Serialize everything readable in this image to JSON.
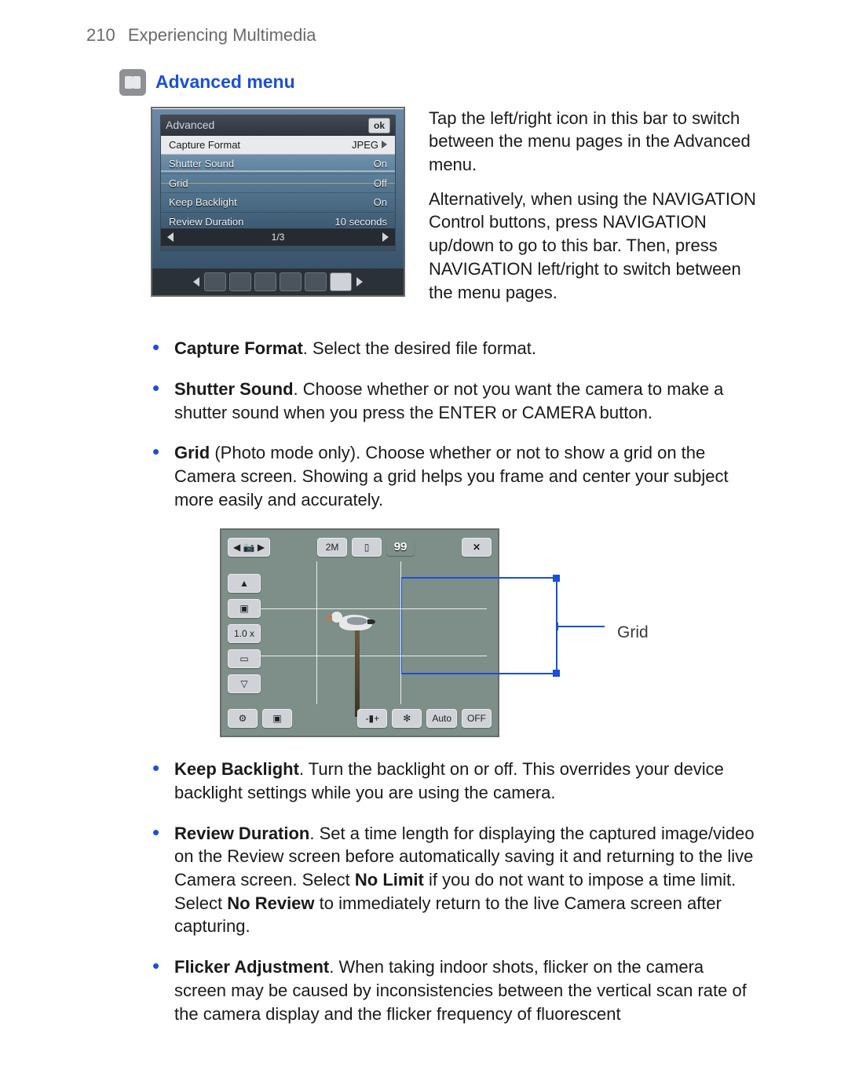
{
  "header": {
    "page_number": "210",
    "chapter_title": "Experiencing Multimedia"
  },
  "section": {
    "title": "Advanced menu"
  },
  "figure1": {
    "panel_title": "Advanced",
    "ok_label": "ok",
    "rows": [
      {
        "label": "Capture Format",
        "value": "JPEG"
      },
      {
        "label": "Shutter Sound",
        "value": "On"
      },
      {
        "label": "Grid",
        "value": "Off"
      },
      {
        "label": "Keep Backlight",
        "value": "On"
      },
      {
        "label": "Review Duration",
        "value": "10 seconds"
      }
    ],
    "pager": "1/3",
    "caption_p1": "Tap the left/right icon in this bar to switch between the menu pages in the Advanced menu.",
    "caption_p2": "Alternatively, when using the NAVIGATION Control buttons, press NAVIGATION up/down to go to this bar. Then, press NAVIGATION left/right to switch between the menu pages."
  },
  "bullets": {
    "b1": {
      "term": "Capture Format",
      "rest": ". Select the desired file format."
    },
    "b2": {
      "term": "Shutter Sound",
      "rest": ". Choose whether or not you want the camera to make a shutter sound when you press the ENTER or CAMERA button."
    },
    "b3": {
      "term": "Grid",
      "note": " (Photo mode only)",
      "rest": ". Choose whether or not to show a grid on the Camera screen. Showing a grid helps you frame and center your subject more easily and accurately."
    },
    "b4": {
      "term": "Keep Backlight",
      "rest": ". Turn the backlight on or off. This overrides your device backlight settings while you are using the camera."
    },
    "b5": {
      "term": "Review Duration",
      "rest_a": ". Set a time length for displaying the captured image/video on the Review screen before automatically saving it and returning to the live Camera screen. Select ",
      "bold_a": "No Limit",
      "rest_b": " if you do not want to impose a time limit. Select ",
      "bold_b": "No Review",
      "rest_c": "  to immediately return to the live Camera screen after capturing."
    },
    "b6": {
      "term": "Flicker Adjustment",
      "rest": ". When taking indoor shots, flicker on the camera screen may be caused by inconsistencies between the vertical scan rate of the camera display and the flicker frequency of fluorescent"
    }
  },
  "figure2": {
    "top": {
      "res": "2M",
      "count": "99",
      "close": "✕"
    },
    "side": {
      "zoom": "1.0 x"
    },
    "callout_label": "Grid"
  }
}
